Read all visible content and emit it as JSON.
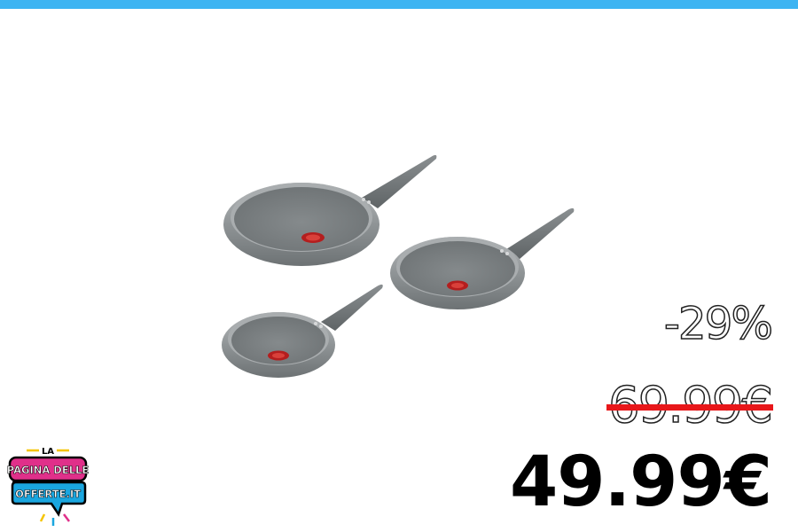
{
  "theme": {
    "top_bar_color": "#3db4f2",
    "strike_color": "#e8171a",
    "logo_pink": "#e0308a",
    "logo_blue": "#1aa6df",
    "logo_yellow": "#f5c400"
  },
  "offer": {
    "discount": "-29%",
    "old_price": "69.99€",
    "new_price": "49.99€"
  },
  "logo": {
    "line1": "LA",
    "line2": "PAGINA DELLE",
    "line3": "OFFERTE.IT"
  },
  "product": {
    "image_icon": "frying-pan-set-icon"
  }
}
